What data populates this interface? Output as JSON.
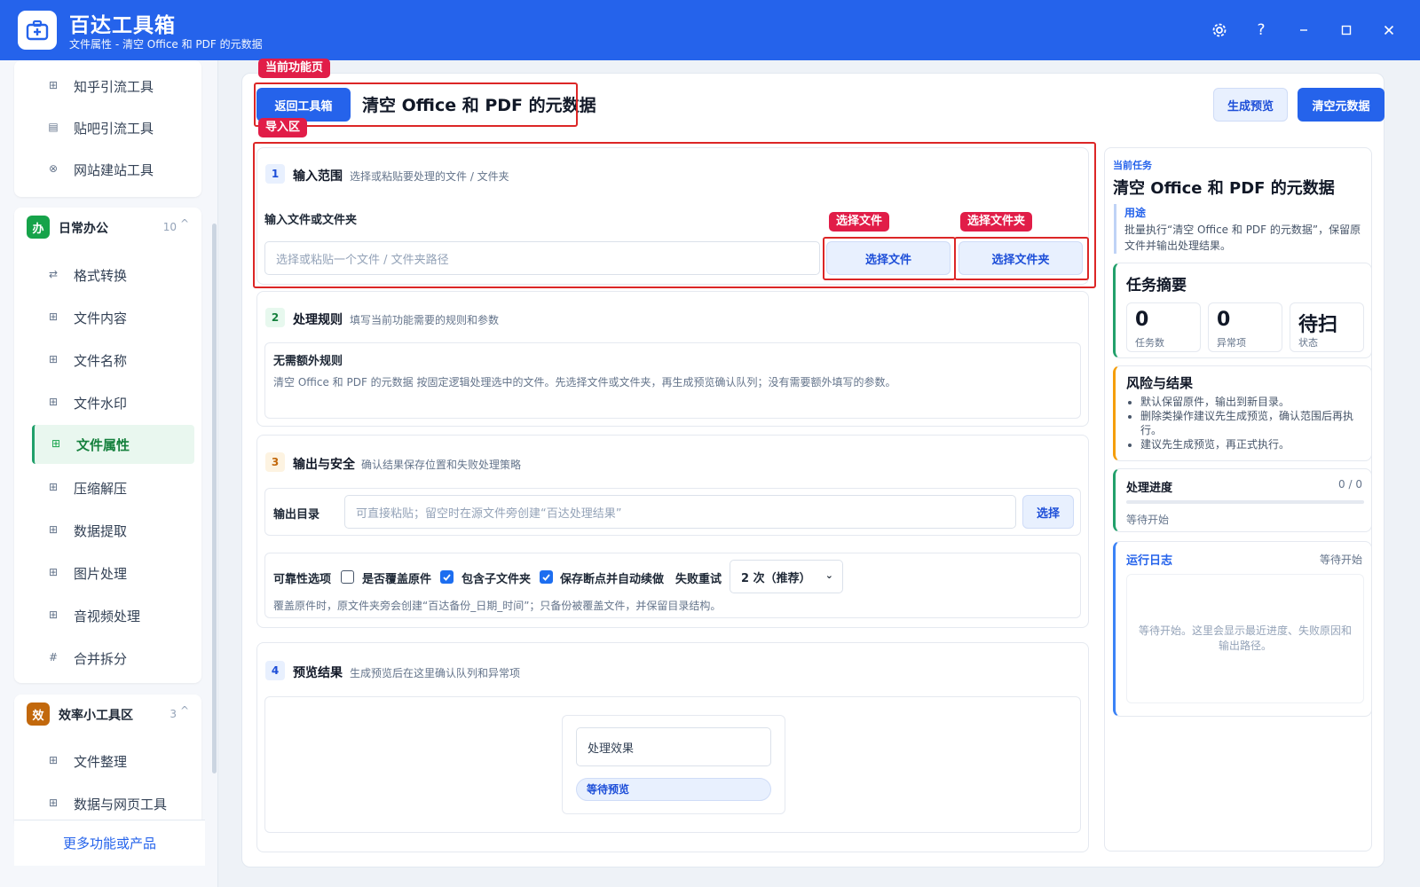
{
  "app": {
    "name": "百达工具箱",
    "subtitle": "文件属性 - 清空 Office 和 PDF 的元数据"
  },
  "sidebar": {
    "top_items": [
      {
        "label": "知乎引流工具",
        "icon": "zhihu-icon"
      },
      {
        "label": "贴吧引流工具",
        "icon": "tieba-icon"
      },
      {
        "label": "网站建站工具",
        "icon": "website-icon"
      }
    ],
    "group_office": {
      "badge": "办",
      "badge_color": "#16a34a",
      "title": "日常办公",
      "count": "10",
      "chevron": "^",
      "items": [
        {
          "label": "格式转换",
          "icon": "convert-icon"
        },
        {
          "label": "文件内容",
          "icon": "grid-icon"
        },
        {
          "label": "文件名称",
          "icon": "grid-icon"
        },
        {
          "label": "文件水印",
          "icon": "grid-icon"
        },
        {
          "label": "文件属性",
          "icon": "grid-icon",
          "active": true
        },
        {
          "label": "压缩解压",
          "icon": "grid-icon"
        },
        {
          "label": "数据提取",
          "icon": "grid-icon"
        },
        {
          "label": "图片处理",
          "icon": "grid-icon"
        },
        {
          "label": "音视频处理",
          "icon": "grid-icon"
        },
        {
          "label": "合并拆分",
          "icon": "hash-icon"
        }
      ]
    },
    "group_efficiency": {
      "badge": "效",
      "badge_color": "#c2680c",
      "title": "效率小工具区",
      "count": "3",
      "chevron": "^",
      "items": [
        {
          "label": "文件整理",
          "icon": "grid-icon"
        },
        {
          "label": "数据与网页工具",
          "icon": "grid-icon"
        }
      ]
    },
    "more_link": "更多功能或产品"
  },
  "main": {
    "back_button": "返回工具箱",
    "title": "清空 Office 和 PDF 的元数据",
    "preview_button": "生成预览",
    "run_button": "清空元数据",
    "step1": {
      "num": "1",
      "title": "输入范围",
      "desc": "选择或粘贴要处理的文件 / 文件夹",
      "field_label": "输入文件或文件夹",
      "placeholder": "选择或粘贴一个文件 / 文件夹路径",
      "choose_file": "选择文件",
      "choose_folder": "选择文件夹"
    },
    "step2": {
      "num": "2",
      "title": "处理规则",
      "desc": "填写当前功能需要的规则和参数",
      "rule_title": "无需额外规则",
      "rule_desc": "清空 Office 和 PDF 的元数据 按固定逻辑处理选中的文件。先选择文件或文件夹，再生成预览确认队列；没有需要额外填写的参数。"
    },
    "step3": {
      "num": "3",
      "title": "输出与安全",
      "desc": "确认结果保存位置和失败处理策略",
      "output_label": "输出目录",
      "output_placeholder": "可直接粘贴；留空时在源文件旁创建“百达处理结果”",
      "choose_button": "选择",
      "reliability_label": "可靠性选项",
      "overwrite_label": "是否覆盖原件",
      "overwrite_checked": false,
      "subfolder_label": "包含子文件夹",
      "subfolder_checked": true,
      "resume_label": "保存断点并自动续做",
      "resume_checked": true,
      "retry_label": "失败重试",
      "retry_value": "2 次（推荐）",
      "note": "覆盖原件时，原文件夹旁会创建“百达备份_日期_时间”；只备份被覆盖文件，并保留目录结构。"
    },
    "step4": {
      "num": "4",
      "title": "预览结果",
      "desc": "生成预览后在这里确认队列和异常项",
      "effect_label": "处理效果",
      "status_pill": "等待预览"
    }
  },
  "annotations": {
    "current_page": "当前功能页",
    "import_area": "导入区",
    "choose_file": "选择文件",
    "choose_folder": "选择文件夹"
  },
  "right": {
    "task_label": "当前任务",
    "task_title": "清空 Office 和 PDF 的元数据",
    "purpose_label": "用途",
    "purpose_text": "批量执行“清空 Office 和 PDF 的元数据”，保留原文件并输出处理结果。",
    "summary_title": "任务摘要",
    "stats": [
      {
        "value": "0",
        "label": "任务数"
      },
      {
        "value": "0",
        "label": "异常项"
      },
      {
        "value": "待扫",
        "label": "状态"
      }
    ],
    "risk_title": "风险与结果",
    "risks": [
      "默认保留原件，输出到新目录。",
      "删除类操作建议先生成预览，确认范围后再执行。",
      "建议先生成预览，再正式执行。"
    ],
    "progress_title": "处理进度",
    "progress_value": "0 / 0",
    "progress_fraction": 0,
    "progress_status": "等待开始",
    "log_title": "运行日志",
    "log_status": "等待开始",
    "log_placeholder": "等待开始。这里会显示最近进度、失败原因和输出路径。"
  },
  "colors": {
    "brand": "#2563eb",
    "annotation": "#dc2626",
    "active_green": "#22a06b"
  }
}
